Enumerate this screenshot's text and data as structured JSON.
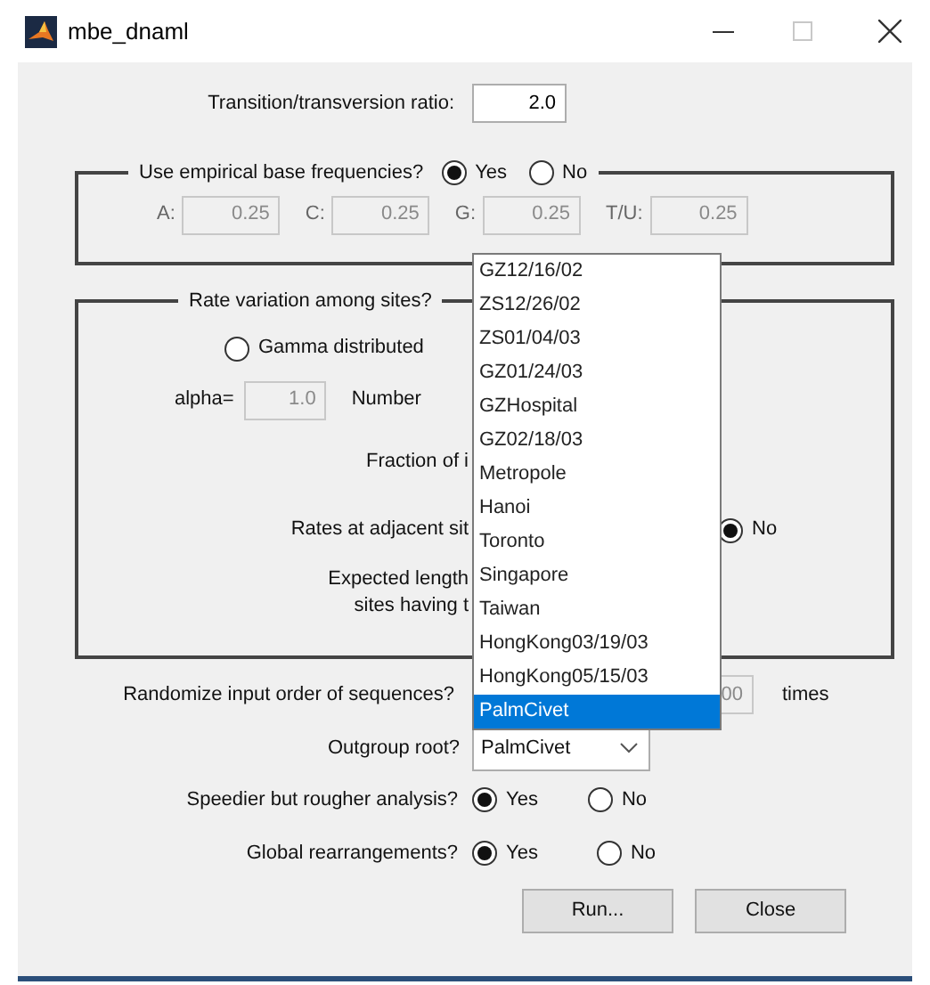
{
  "window": {
    "title": "mbe_dnaml"
  },
  "ratio": {
    "label": "Transition/transversion ratio:",
    "value": "2.0",
    "disabled": false
  },
  "base_frequencies": {
    "label": "Use empirical base frequencies?",
    "options": [
      {
        "label": "Yes",
        "selected": true
      },
      {
        "label": "No",
        "selected": false
      }
    ],
    "fields": [
      {
        "label": "A:",
        "value": "0.25",
        "disabled": true
      },
      {
        "label": "C:",
        "value": "0.25",
        "disabled": true
      },
      {
        "label": "G:",
        "value": "0.25",
        "disabled": true
      },
      {
        "label": "T/U:",
        "value": "0.25",
        "disabled": true
      }
    ]
  },
  "rate_variation": {
    "label": "Rate variation among sites?",
    "gamma": {
      "label": "Gamma distributed",
      "selected": false
    },
    "alpha": {
      "label": "alpha=",
      "value": "1.0",
      "disabled": true
    },
    "number_label": "Number",
    "fraction_label": "Fraction of i",
    "adjacent": {
      "label": "Rates at adjacent sit",
      "option": {
        "label": "No",
        "selected": true
      }
    },
    "expected_length": [
      "Expected length",
      "sites having t"
    ]
  },
  "randomize": {
    "label": "Randomize input order of sequences?",
    "value": "00",
    "disabled": true,
    "unit": "times"
  },
  "outgroup": {
    "label": "Outgroup root?",
    "value": "PalmCivet",
    "options": [
      {
        "label": "GZ12/16/02",
        "selected": false
      },
      {
        "label": "ZS12/26/02",
        "selected": false
      },
      {
        "label": "ZS01/04/03",
        "selected": false
      },
      {
        "label": "GZ01/24/03",
        "selected": false
      },
      {
        "label": "GZHospital",
        "selected": false
      },
      {
        "label": "GZ02/18/03",
        "selected": false
      },
      {
        "label": "Metropole",
        "selected": false
      },
      {
        "label": "Hanoi",
        "selected": false
      },
      {
        "label": "Toronto",
        "selected": false
      },
      {
        "label": "Singapore",
        "selected": false
      },
      {
        "label": "Taiwan",
        "selected": false
      },
      {
        "label": "HongKong03/19/03",
        "selected": false
      },
      {
        "label": "HongKong05/15/03",
        "selected": false
      },
      {
        "label": "PalmCivet",
        "selected": true
      }
    ]
  },
  "speedier": {
    "label": "Speedier but rougher analysis?",
    "options": [
      {
        "label": "Yes",
        "selected": true
      },
      {
        "label": "No",
        "selected": false
      }
    ]
  },
  "global": {
    "label": "Global rearrangements?",
    "options": [
      {
        "label": "Yes",
        "selected": true
      },
      {
        "label": "No",
        "selected": false
      }
    ]
  },
  "buttons": [
    "Run...",
    "Close"
  ]
}
